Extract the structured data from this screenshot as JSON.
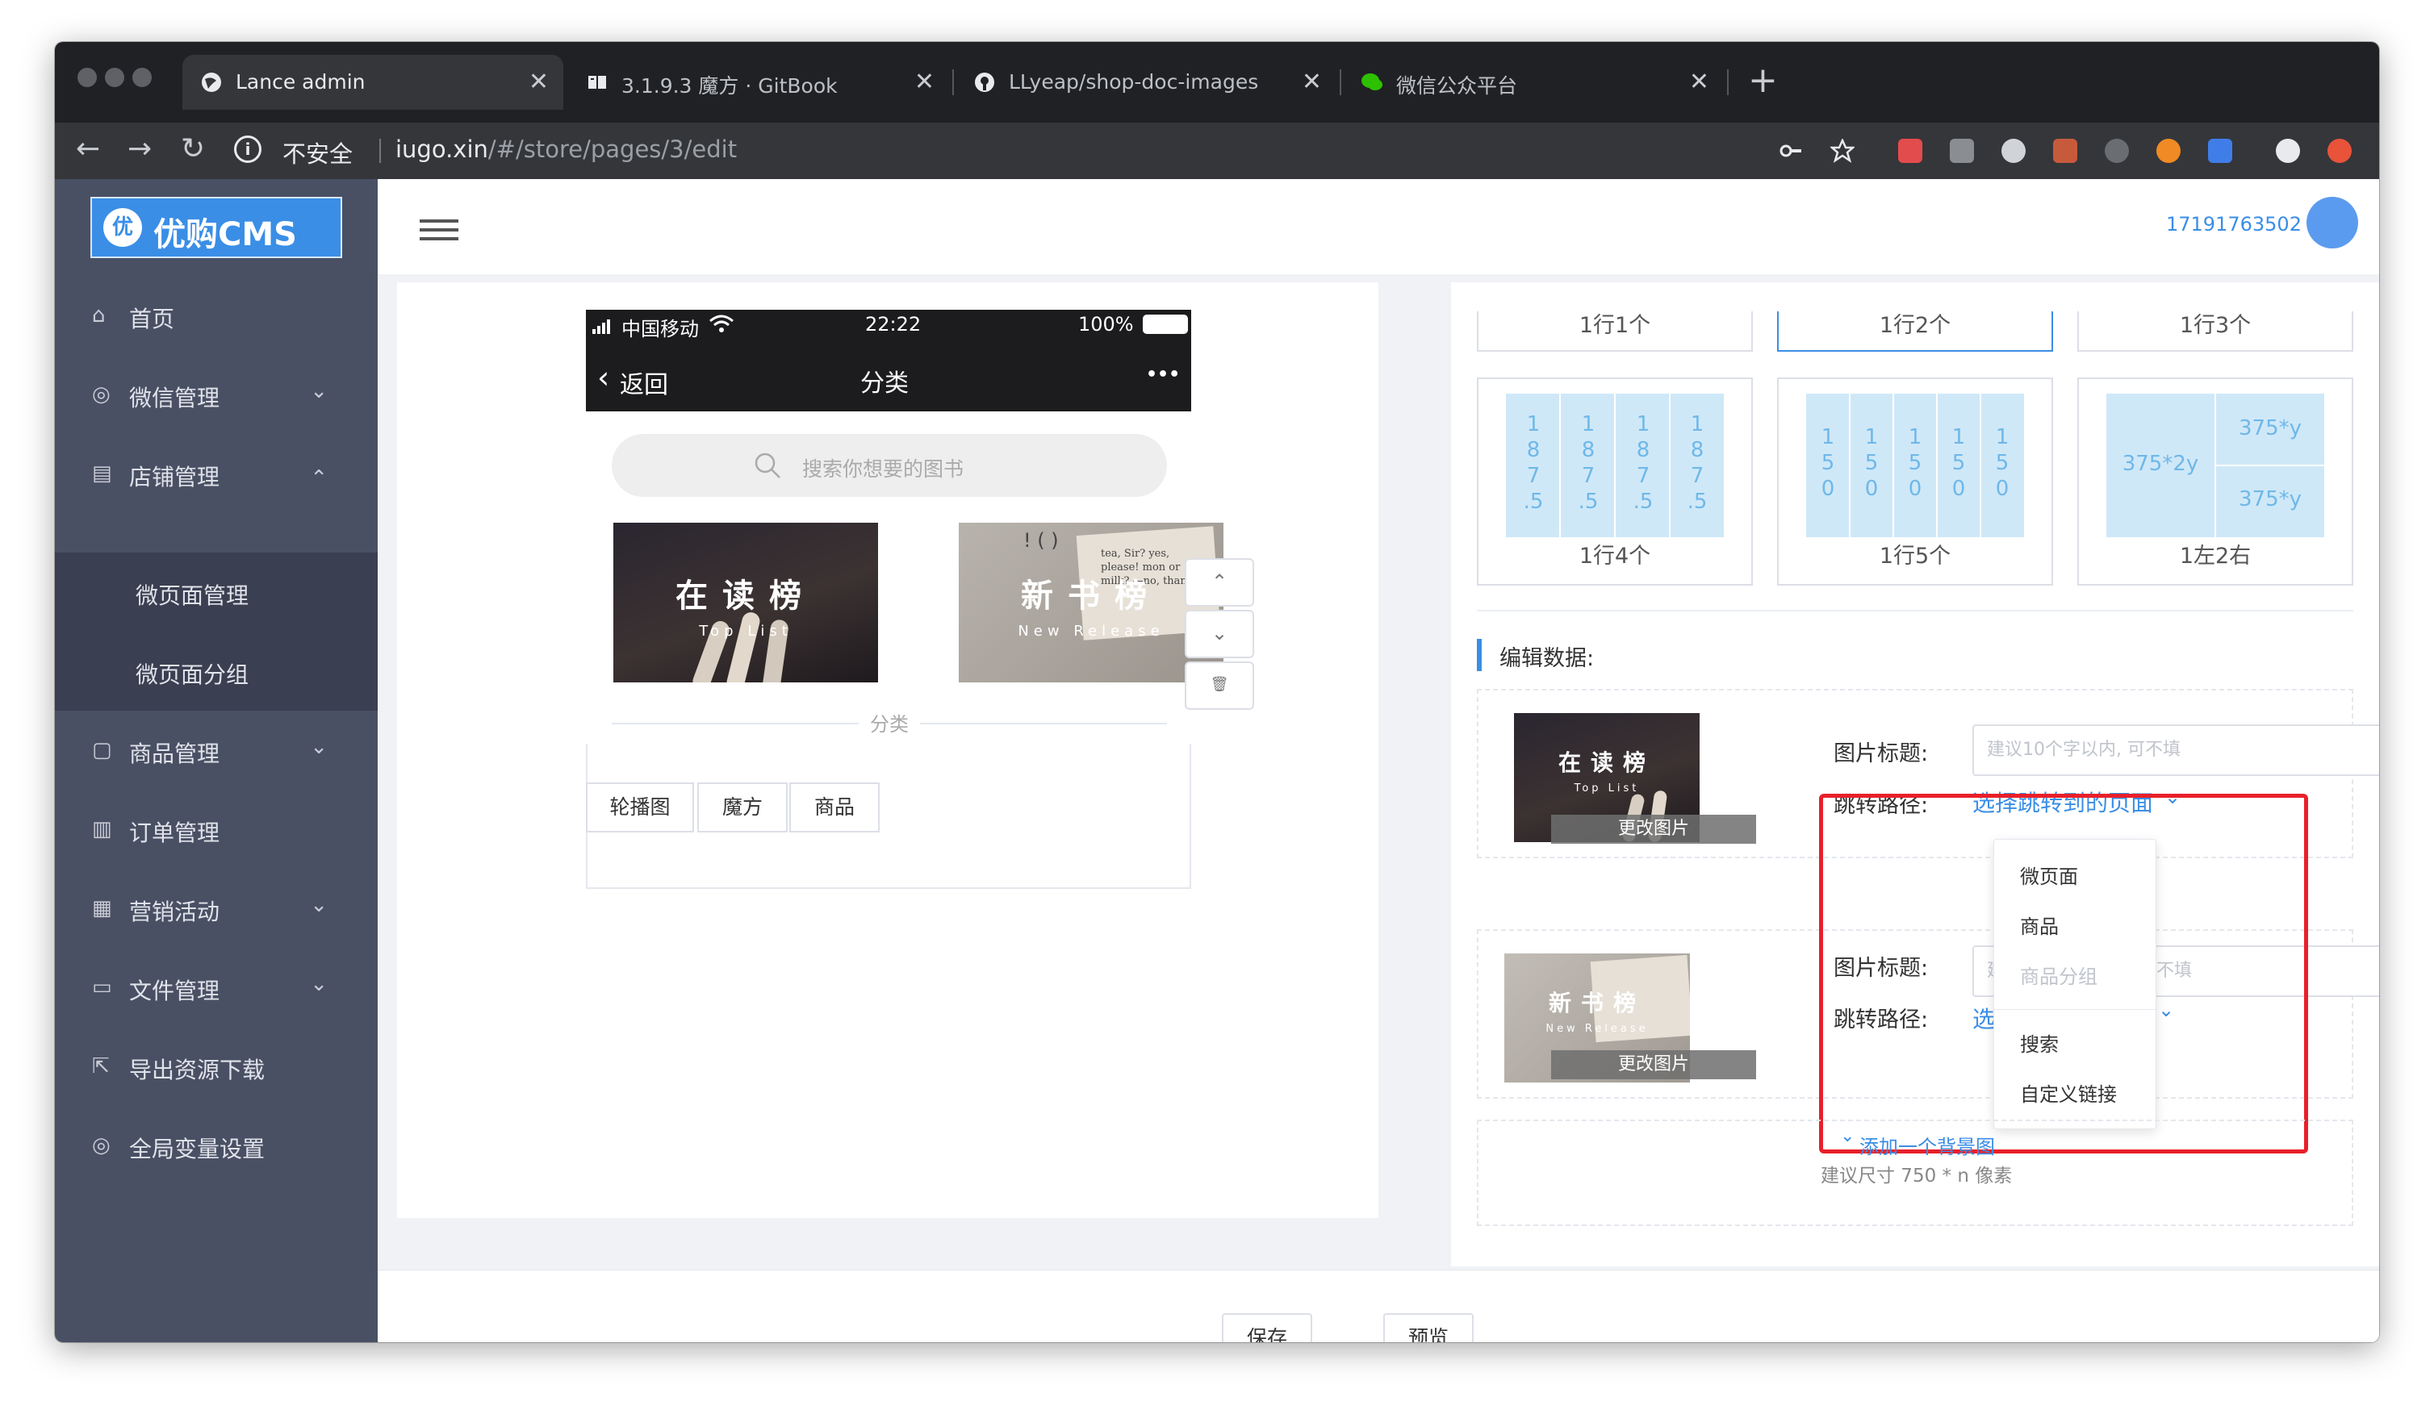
{
  "browser": {
    "tabs": [
      {
        "title": "Lance admin",
        "active": true
      },
      {
        "title": "3.1.9.3 魔方 · GitBook",
        "active": false
      },
      {
        "title": "LLyeap/shop-doc-images",
        "active": false
      },
      {
        "title": "微信公众平台",
        "active": false
      }
    ],
    "close_glyph": "✕",
    "new_tab_glyph": "+",
    "security_label": "不安全",
    "url_host": "iugo.xin",
    "url_path": "/#/store/pages/3/edit",
    "nav": {
      "back": "←",
      "forward": "→",
      "reload": "↻"
    }
  },
  "app": {
    "logo_badge": "优",
    "logo_text": "优购CMS",
    "user_phone": "17191763502",
    "sidebar": [
      {
        "label": "首页",
        "icon": "home-icon",
        "glyph": "⌂"
      },
      {
        "label": "微信管理",
        "icon": "wechat-icon",
        "glyph": "◎"
      },
      {
        "label": "店铺管理",
        "icon": "store-icon",
        "glyph": "▤"
      },
      {
        "label": "商品管理",
        "icon": "bag-icon",
        "glyph": "▢"
      },
      {
        "label": "订单管理",
        "icon": "order-icon",
        "glyph": "▥"
      },
      {
        "label": "营销活动",
        "icon": "gift-icon",
        "glyph": "▦"
      },
      {
        "label": "文件管理",
        "icon": "folder-icon",
        "glyph": "▭"
      },
      {
        "label": "导出资源下载",
        "icon": "export-icon",
        "glyph": "⇱"
      },
      {
        "label": "全局变量设置",
        "icon": "settings-icon",
        "glyph": "◎"
      }
    ],
    "submenu": [
      {
        "label": "微页面管理"
      },
      {
        "label": "微页面分组"
      }
    ],
    "arrow_down": "⌄",
    "arrow_up": "⌃"
  },
  "preview": {
    "carrier": "中国移动",
    "time": "22:22",
    "battery": "100%",
    "back_label": "返回",
    "page_title": "分类",
    "more_glyph": "•••",
    "search_placeholder": "搜索你想要的图书",
    "cube_items": [
      {
        "title": "在读榜",
        "subtitle": "Top List"
      },
      {
        "title": "新书榜",
        "subtitle": "New Release"
      }
    ],
    "book_text": "tea, Sir? yes, please! mon or milk? —no, thanks.",
    "divider_label": "分类",
    "component_tabs": [
      "轮播图",
      "魔方",
      "商品"
    ],
    "side_buttons": {
      "up": "⌃",
      "down": "⌄",
      "delete": "🗑"
    }
  },
  "editor": {
    "layout_row1": [
      "1行1个",
      "1行2个",
      "1行3个"
    ],
    "layout_row2": [
      {
        "label": "1行4个",
        "cells": [
          "1\n8\n7\n.5",
          "1\n8\n7\n.5",
          "1\n8\n7\n.5",
          "1\n8\n7\n.5"
        ]
      },
      {
        "label": "1行5个",
        "cells": [
          "1\n5\n0",
          "1\n5\n0",
          "1\n5\n0",
          "1\n5\n0",
          "1\n5\n0"
        ]
      },
      {
        "label": "1左2右",
        "left": "375*2y",
        "top_right": "375*y",
        "bottom_right": "375*y"
      }
    ],
    "section_title": "编辑数据:",
    "items": [
      {
        "image_title": "在读榜",
        "image_subtitle": "Top List",
        "change_image": "更改图片",
        "title_label": "图片标题:",
        "title_placeholder": "建议10个字以内, 可不填",
        "path_label": "跳转路径:",
        "path_link": "选择跳转到的页面"
      },
      {
        "image_title": "新书榜",
        "image_subtitle": "New Release",
        "change_image": "更改图片",
        "title_label": "图片标题:",
        "title_placeholder_left": "建",
        "title_placeholder_right": "不填",
        "path_label": "跳转路径:",
        "path_link_partial": "选"
      }
    ],
    "dropdown": [
      {
        "label": "微页面",
        "disabled": false
      },
      {
        "label": "商品",
        "disabled": false
      },
      {
        "label": "商品分组",
        "disabled": true
      },
      {
        "label": "搜索",
        "disabled": false
      },
      {
        "label": "自定义链接",
        "disabled": false
      }
    ],
    "add_background": "添加一个背景图",
    "size_hint": "建议尺寸 750 * n 像素"
  },
  "footer": {
    "save": "保存",
    "preview": "预览"
  },
  "colors": {
    "accent": "#3a8ee6",
    "sidebar": "#4a5064",
    "highlight": "#e8202a",
    "cell": "#cfe8f8"
  }
}
